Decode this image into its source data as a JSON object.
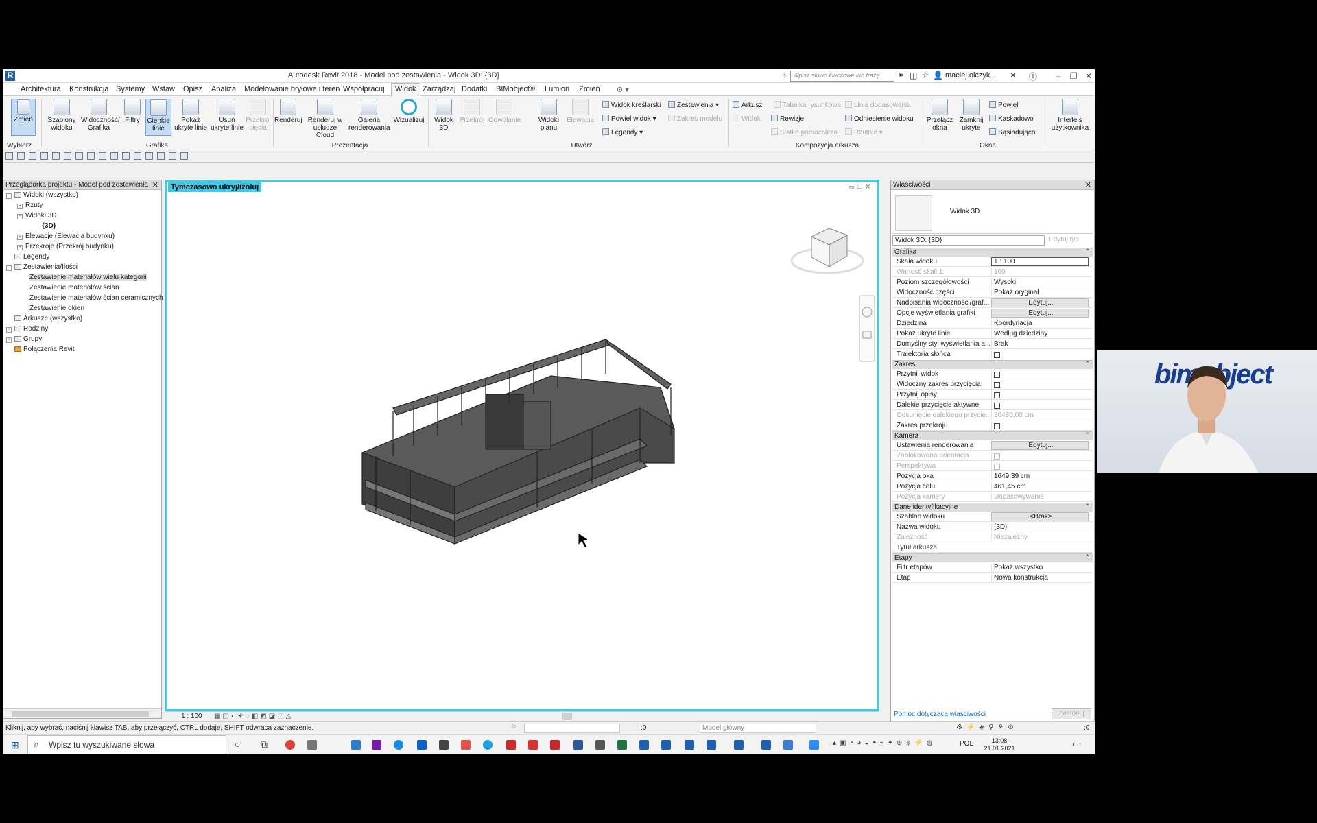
{
  "window": {
    "title": "Autodesk Revit 2018 -   Model pod zestawienia - Widok 3D: {3D}",
    "search_placeholder": "Wpisz słowo kluczowe lub frazę",
    "user": "maciej.olczyk..."
  },
  "menu": [
    "Architektura",
    "Konstrukcja",
    "Systemy",
    "Wstaw",
    "Opisz",
    "Analiza",
    "Modelowanie bryłowe i teren",
    "Współpracuj",
    "Widok",
    "Zarządzaj",
    "Dodatki",
    "BIMobject®",
    "Lumion",
    "Zmień"
  ],
  "menu_active": "Widok",
  "ribbon": {
    "modify": "Zmień",
    "select_label": "Wybierz",
    "grafika": [
      "Szablony widoku",
      "Widoczność/ Grafika",
      "Filtry",
      "Cienkie linie",
      "Pokaż ukryte linie",
      "Usuń ukryte linie",
      "Przekrój cięcia"
    ],
    "grafika_label": "Grafika",
    "prezentacja": [
      "Renderuj",
      "Renderuj w usłudze Cloud",
      "Galeria renderowania",
      "Wizualizuj"
    ],
    "prezentacja_label": "Prezentacja",
    "utworz_big": [
      "Widok 3D",
      "Przekrój",
      "Odwołanie",
      "Widoki planu",
      "Elewacja"
    ],
    "utworz_small": [
      "Widok kreślarski",
      "Powiel widok",
      "Legendy",
      "Zestawienia",
      "Zakres modelu"
    ],
    "utworz_label": "Utwórz",
    "kompozycja_small": [
      "Arkusz",
      "Widok",
      "Tabelka rysunkowa",
      "Rewizje",
      "Siatka pomocnicza",
      "Linia dopasowania",
      "Odniesienie widoku",
      "Rzutnie"
    ],
    "kompozycja_label": "Kompozycja arkusza",
    "okna_big": [
      "Przełącz okna",
      "Zamknij ukryte"
    ],
    "okna_small": [
      "Powiel",
      "Kaskadowo",
      "Sąsiadująco"
    ],
    "okna_label": "Okna",
    "interfejs": "Interfejs użytkownika"
  },
  "browser": {
    "title": "Przeglądarka projektu - Model pod zestawienia",
    "items": [
      "Widoki (wszystko)",
      "Rzuty",
      "Widoki 3D",
      "{3D}",
      "Elewacje (Elewacja budynku)",
      "Przekroje (Przekrój budynku)",
      "Legendy",
      "Zestawienia/Ilości",
      "Zestawienie materiałów wielu kategorii",
      "Zestawienie materiałów ścian",
      "Zestawienie materiałów ścian ceramicznych",
      "Zestawienie okien",
      "Arkusze (wszystko)",
      "Rodziny",
      "Grupy",
      "Połączenia Revit"
    ]
  },
  "view": {
    "badge": "Tymczasowo ukryj/izoluj",
    "scale": "1 : 100"
  },
  "properties": {
    "title": "Właściwości",
    "type_name": "Widok 3D",
    "selector": "Widok 3D: {3D}",
    "edit_type": "Edytuj typ",
    "sections": [
      {
        "name": "Grafika",
        "rows": [
          {
            "k": "Skala widoku",
            "v": "1 : 100"
          },
          {
            "k": "Wartość skali    1:",
            "v": "100"
          },
          {
            "k": "Poziom szczegółowości",
            "v": "Wysoki"
          },
          {
            "k": "Widoczność części",
            "v": "Pokaż oryginał"
          },
          {
            "k": "Nadpisania widoczności/graf...",
            "v": "Edytuj..."
          },
          {
            "k": "Opcje wyświetlania grafiki",
            "v": "Edytuj..."
          },
          {
            "k": "Dziedzina",
            "v": "Koordynacja"
          },
          {
            "k": "Pokaż ukryte linie",
            "v": "Według dziedziny"
          },
          {
            "k": "Domyślny styl wyświetlania a...",
            "v": "Brak"
          },
          {
            "k": "Trajektoria słońca",
            "v": ""
          }
        ]
      },
      {
        "name": "Zakres",
        "rows": [
          {
            "k": "Przytnij widok",
            "v": ""
          },
          {
            "k": "Widoczny zakres przycięcia",
            "v": ""
          },
          {
            "k": "Przytnij opisy",
            "v": ""
          },
          {
            "k": "Dalekie przycięcie aktywne",
            "v": ""
          },
          {
            "k": "Odsunięcie dalekiego przycię...",
            "v": "30480,00 cm"
          },
          {
            "k": "Zakres przekroju",
            "v": ""
          }
        ]
      },
      {
        "name": "Kamera",
        "rows": [
          {
            "k": "Ustawienia renderowania",
            "v": "Edytuj..."
          },
          {
            "k": "Zablokowana orientacja",
            "v": ""
          },
          {
            "k": "Perspektywa",
            "v": ""
          },
          {
            "k": "Pozycja oka",
            "v": "1649,39 cm"
          },
          {
            "k": "Pozycja celu",
            "v": "461,45 cm"
          },
          {
            "k": "Pozycja kamery",
            "v": "Dopasowywanie"
          }
        ]
      },
      {
        "name": "Dane identyfikacyjne",
        "rows": [
          {
            "k": "Szablon widoku",
            "v": "<Brak>"
          },
          {
            "k": "Nazwa widoku",
            "v": "{3D}"
          },
          {
            "k": "Zależność",
            "v": "Niezależny"
          },
          {
            "k": "Tytuł arkusza",
            "v": ""
          }
        ]
      },
      {
        "name": "Etapy",
        "rows": [
          {
            "k": "Filtr etapów",
            "v": "Pokaż wszystko"
          },
          {
            "k": "Etap",
            "v": "Nowa konstrukcja"
          }
        ]
      }
    ],
    "help": "Pomoc dotycząca właściwości",
    "apply": "Zastosuj"
  },
  "status": {
    "hint": "Kliknij, aby wybrać, naciśnij klawisz TAB, aby przełączyć, CTRL dodaje, SHIFT odwraca zaznaczenie.",
    "count": ":0",
    "model": "Model główny",
    "filter_count": ":0"
  },
  "taskbar": {
    "search": "Wpisz tu wyszukiwane słowa",
    "lang": "POL",
    "time": "13:08",
    "date": "21.01.2021"
  },
  "webcam": {
    "brand": "bimobject"
  }
}
